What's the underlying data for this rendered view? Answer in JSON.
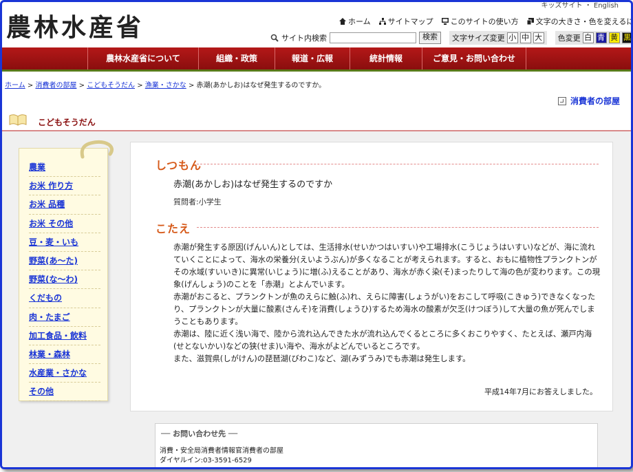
{
  "header": {
    "logo": "農林水産省",
    "top_cut": "キッズサイト ・ English",
    "home": "ホーム",
    "sitemap": "サイトマップ",
    "howto": "このサイトの使い方",
    "textcolor": "文字の大きさ・色を変えるには",
    "search_label": "サイト内検索",
    "search_button": "検索",
    "search_value": "",
    "fontsize_label": "文字サイズ変更",
    "size_small": "小",
    "size_medium": "中",
    "size_large": "大",
    "color_label": "色変更",
    "color_white": "白",
    "color_blue": "青",
    "color_yellow": "黄",
    "color_black": "黒"
  },
  "nav": [
    "農林水産省について",
    "組織・政策",
    "報道・広報",
    "統計情報",
    "ご意見・お問い合わせ"
  ],
  "breadcrumb": {
    "items": [
      "ホーム",
      "消費者の部屋",
      "こどもそうだん",
      "漁業・さかな"
    ],
    "current": "赤潮(あかしお)はなぜ発生するのですか。"
  },
  "room_link": "消費者の部屋",
  "section_title": "こどもそうだん",
  "sidebar": [
    "農業",
    "お米 作り方",
    "お米 品種",
    "お米 その他",
    "豆・麦・いも",
    "野菜(あ〜た)",
    "野菜(な〜わ)",
    "くだもの",
    "肉・たまご",
    "加工食品・飲料",
    "林業・森林",
    "水産業・さかな",
    "その他"
  ],
  "qa": {
    "q_heading": "しつもん",
    "question": "赤潮(あかしお)はなぜ発生するのですか",
    "asker": "質問者:小学生",
    "a_heading": "こたえ",
    "answer": [
      "赤潮が発生する原因(げんいん)としては、生活排水(せいかつはいすい)や工場排水(こうじょうはいすい)などが、海に流れていくことによって、海水の栄養分(えいようぶん)が多くなることが考えられます。すると、おもに植物性プランクトンがその水域(すいいき)に異常(いじょう)に増(ふ)えることがあり、海水が赤く染(そ)まったりして海の色が変わります。この現象(げんしょう)のことを「赤潮」とよんでいます。",
      "赤潮がおこると、プランクトンが魚のえらに触(ふ)れ、えらに障害(しょうがい)をおこして呼吸(こきゅう)できなくなったり、プランクトンが大量に酸素(さんそ)を消費(しょうひ)するため海水の酸素が欠乏(けつぼう)して大量の魚が死んでしまうこともあります。",
      "赤潮は、陸に近く浅い海で、陸から流れ込んできた水が流れ込んでくるところに多くおこりやすく、たとえば、瀬戸内海(せとないかい)などの狭(せま)い海や、海水がよどんでいるところです。",
      "また、滋賀県(しがけん)の琵琶湖(びわこ)など、湖(みずうみ)でも赤潮は発生します。"
    ],
    "date": "平成14年7月にお答えしました。"
  },
  "contact": {
    "title": "── お問い合わせ先 ──",
    "line1": "消費・安全局消費者情報官消費者の部屋",
    "line2": "ダイヤルイン:03-3591-6529"
  }
}
